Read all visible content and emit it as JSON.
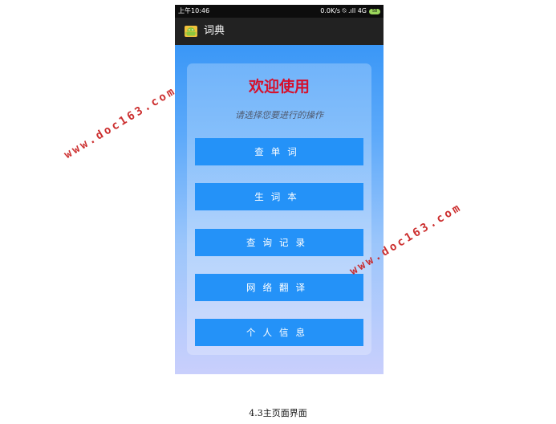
{
  "status_bar": {
    "time": "上午10:46",
    "indicators": "0.0K/s ⍉ .ıll 4G",
    "battery": "58"
  },
  "app_bar": {
    "icon": "android-robot-icon",
    "title": "词典"
  },
  "main": {
    "welcome": "欢迎使用",
    "subtitle": "请选择您要进行的操作",
    "buttons": [
      {
        "label": "查单词"
      },
      {
        "label": "生词本"
      },
      {
        "label": "查询记录"
      },
      {
        "label": "网络翻译"
      },
      {
        "label": "个人信息"
      }
    ]
  },
  "caption": "4.3主页面界面",
  "watermarks": [
    "www.doc163.com",
    "www.doc163.com"
  ],
  "colors": {
    "button": "#2492f8",
    "welcome_text": "#d6102c",
    "action_bar": "#222222",
    "watermark": "#c81e1e"
  }
}
